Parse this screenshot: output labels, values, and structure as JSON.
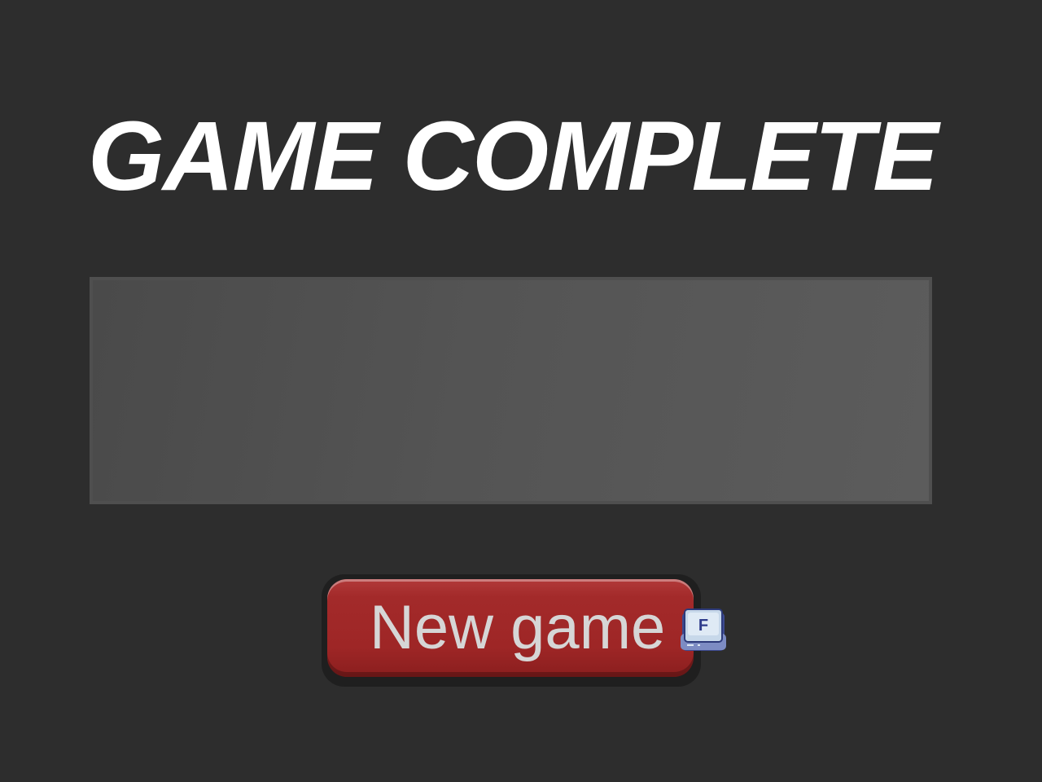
{
  "screen": {
    "title": "GAME COMPLETE"
  },
  "actions": {
    "new_game_label": "New game",
    "new_game_hotkey": "F",
    "hotkey_icon": "keyboard-key-icon"
  },
  "colors": {
    "background": "#2d2d2d",
    "title": "#ffffff",
    "panel": "#555555",
    "button": "#a32a2a",
    "button_text": "#d6d6d6"
  }
}
